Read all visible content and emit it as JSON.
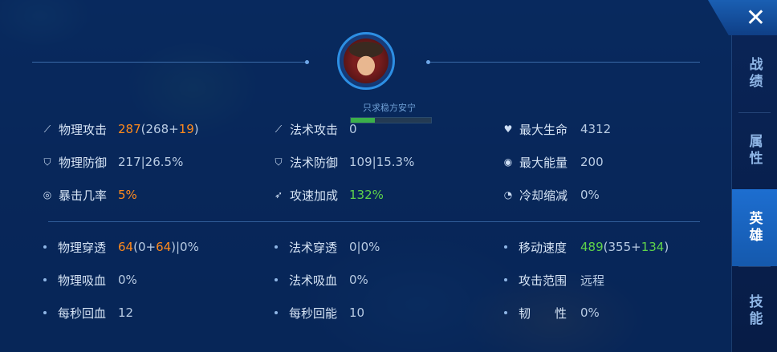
{
  "header": {
    "player_name": "只求稳方安宁",
    "hp_fraction": 0.3
  },
  "close_label": "✕",
  "sidebar": {
    "tabs": [
      {
        "label": "战绩",
        "active": false
      },
      {
        "label": "属性",
        "active": false
      },
      {
        "label": "英雄",
        "active": true
      },
      {
        "label": "技能",
        "active": false
      }
    ]
  },
  "primary_stats": [
    {
      "label": "物理攻击",
      "value_parts": [
        {
          "t": "287",
          "c": "orange"
        },
        {
          "t": "(268+",
          "c": ""
        },
        {
          "t": "19",
          "c": "orange"
        },
        {
          "t": ")",
          "c": ""
        }
      ],
      "icon": "sword-icon"
    },
    {
      "label": "法术攻击",
      "value_parts": [
        {
          "t": "0",
          "c": ""
        }
      ],
      "icon": "wand-icon"
    },
    {
      "label": "最大生命",
      "value_parts": [
        {
          "t": "4312",
          "c": ""
        }
      ],
      "icon": "heart-icon"
    },
    {
      "label": "物理防御",
      "value_parts": [
        {
          "t": "217|26.5%",
          "c": ""
        }
      ],
      "icon": "shield-icon"
    },
    {
      "label": "法术防御",
      "value_parts": [
        {
          "t": "109|15.3%",
          "c": ""
        }
      ],
      "icon": "magic-shield-icon"
    },
    {
      "label": "最大能量",
      "value_parts": [
        {
          "t": "200",
          "c": ""
        }
      ],
      "icon": "energy-icon"
    },
    {
      "label": "暴击几率",
      "value_parts": [
        {
          "t": "5%",
          "c": "orange"
        }
      ],
      "icon": "crit-icon"
    },
    {
      "label": "攻速加成",
      "value_parts": [
        {
          "t": "132%",
          "c": "green"
        }
      ],
      "icon": "attack-speed-icon"
    },
    {
      "label": "冷却缩减",
      "value_parts": [
        {
          "t": "0%",
          "c": ""
        }
      ],
      "icon": "cooldown-icon"
    }
  ],
  "secondary_stats": [
    {
      "label": "物理穿透",
      "value_parts": [
        {
          "t": "64",
          "c": "orange"
        },
        {
          "t": "(0+",
          "c": ""
        },
        {
          "t": "64",
          "c": "orange"
        },
        {
          "t": ")|0%",
          "c": ""
        }
      ]
    },
    {
      "label": "法术穿透",
      "value_parts": [
        {
          "t": "0|0%",
          "c": ""
        }
      ]
    },
    {
      "label": "移动速度",
      "value_parts": [
        {
          "t": "489",
          "c": "green"
        },
        {
          "t": "(355+",
          "c": ""
        },
        {
          "t": "134",
          "c": "green"
        },
        {
          "t": ")",
          "c": ""
        }
      ]
    },
    {
      "label": "物理吸血",
      "value_parts": [
        {
          "t": "0%",
          "c": ""
        }
      ]
    },
    {
      "label": "法术吸血",
      "value_parts": [
        {
          "t": "0%",
          "c": ""
        }
      ]
    },
    {
      "label": "攻击范围",
      "value_parts": [
        {
          "t": "远程",
          "c": ""
        }
      ]
    },
    {
      "label": "每秒回血",
      "value_parts": [
        {
          "t": "12",
          "c": ""
        }
      ]
    },
    {
      "label": "每秒回能",
      "value_parts": [
        {
          "t": "10",
          "c": ""
        }
      ]
    },
    {
      "label": "韧　　性",
      "value_parts": [
        {
          "t": "0%",
          "c": ""
        }
      ]
    }
  ],
  "colors": {
    "accent": "#1d6ed0",
    "orange": "#ff8a1c",
    "green": "#5fd34a"
  }
}
